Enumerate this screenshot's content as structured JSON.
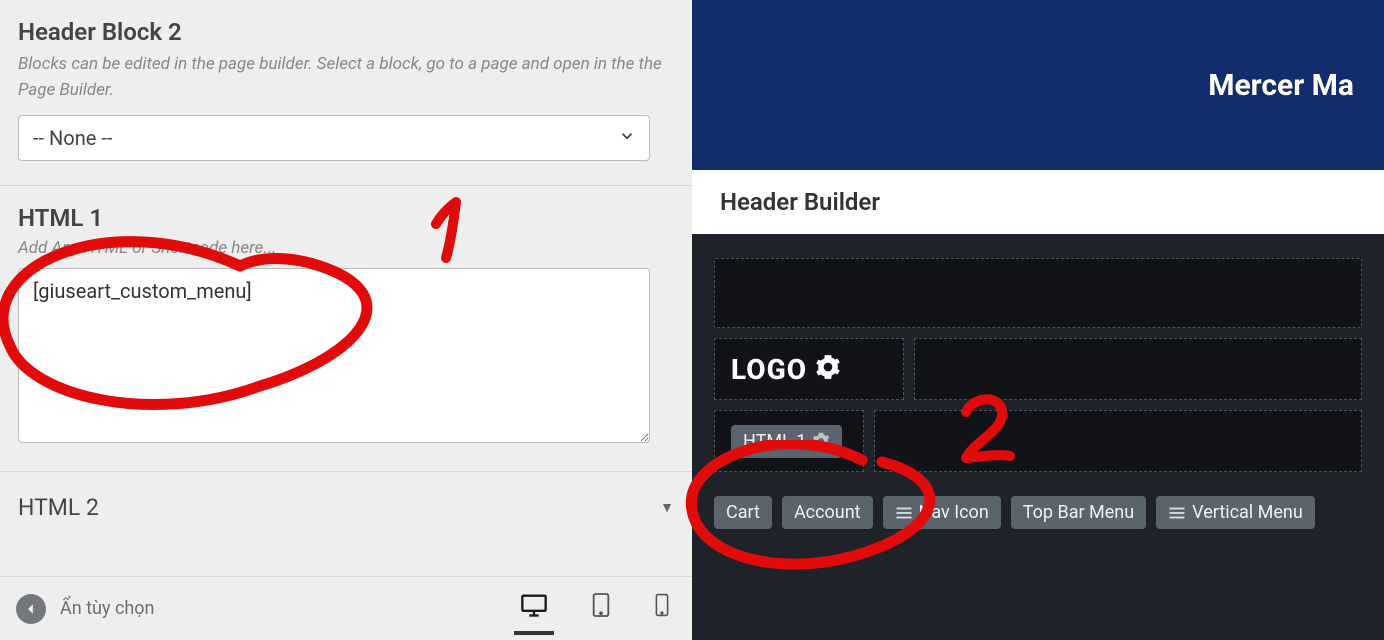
{
  "left": {
    "headerBlock2": {
      "title": "Header Block 2",
      "desc": "Blocks can be edited in the page builder. Select a block, go to a page and open in the the Page Builder.",
      "selected": "-- None --"
    },
    "html1": {
      "title": "HTML 1",
      "hint": "Add Any HTML or Shortcode here...",
      "value": "[giuseart_custom_menu]"
    },
    "html2": {
      "title": "HTML 2"
    },
    "footer": {
      "hideLabel": "Ẩn tùy chọn"
    }
  },
  "right": {
    "brand": "Mercer Ma",
    "builderTitle": "Header Builder",
    "logoLabel": "LOGO",
    "html1Chip": "HTML 1",
    "palette": {
      "cart": "Cart",
      "account": "Account",
      "navIcon": "Nav Icon",
      "topBarMenu": "Top Bar Menu",
      "verticalMenu": "Vertical Menu"
    }
  },
  "annotations": {
    "one": "1",
    "two": "2"
  }
}
